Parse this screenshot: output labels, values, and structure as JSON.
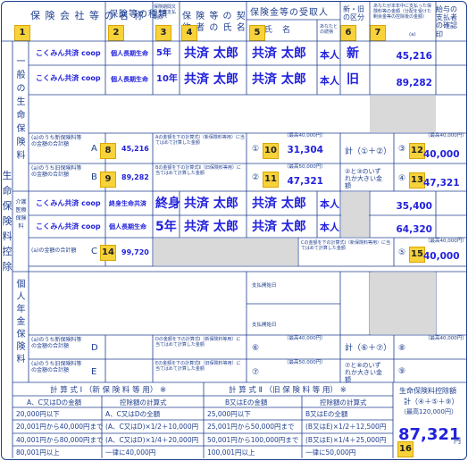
{
  "header": {
    "company": "保 険 会 社 等 の 名 称",
    "type": "保険等の種類",
    "period": "保険期間又は年金支払期間",
    "contractor": "保 険 等 の 契 約 者 の 氏 名",
    "recipient": "保険金等の受取人",
    "recipient_name": "氏　名",
    "relation": "あなたとの続柄",
    "newold": "新・旧の区分",
    "amount": "あなたが本年中に支払った保険料等の金額（分配を受けた剰余金等の控除後の金額）",
    "confirm": "給与の支払者の確認印",
    "col_a": "(a)"
  },
  "badges": [
    "1",
    "2",
    "3",
    "4",
    "5",
    "6",
    "7",
    "8",
    "9",
    "10",
    "11",
    "12",
    "13",
    "14",
    "15",
    "16"
  ],
  "section": {
    "main": "生命保険料控除",
    "general": "一般の生命保険料",
    "care": "介護医療保険料",
    "pension": "個人年金保険料"
  },
  "general_rows": [
    {
      "company": "こくみん共済 coop",
      "type": "個人長期生命",
      "period": "5年",
      "contractor": "共済 太郎",
      "recipient": "共済 太郎",
      "relation": "本人",
      "newold": "新",
      "amount": "45,216"
    },
    {
      "company": "こくみん共済 coop",
      "type": "個人長期生命",
      "period": "10年",
      "contractor": "共済 太郎",
      "recipient": "共済 太郎",
      "relation": "本人",
      "newold": "旧",
      "amount": "89,282"
    }
  ],
  "general_totals": {
    "a_label": "(a)のうち新保険料等の金額の合計額",
    "a_letter": "A",
    "a_value": "45,216",
    "a_text": "Aの金額を下の計算式Ⅰ（新保険料等用）に当てはめて計算した金額",
    "a_circ": "①",
    "a_result": "31,304",
    "a_max": "（最高40,000円）",
    "b_label": "(a)のうち旧保険料等の金額の合計額",
    "b_letter": "B",
    "b_value": "89,282",
    "b_text": "Bの金額を下の計算式Ⅱ（旧保険料等用）に当てはめて計算した金額",
    "b_circ": "②",
    "b_result": "47,321",
    "b_max": "（最高50,000円）",
    "calc": "計（①＋②）",
    "calc_circ": "③",
    "calc_value": "40,000",
    "calc_max": "（最高40,000円）",
    "compare": "②と③のいずれか大きい金額",
    "compare_circ": "④",
    "compare_value": "47,321",
    "yen": "円"
  },
  "care_rows": [
    {
      "company": "こくみん共済 coop",
      "type": "終身生命共済",
      "period": "終身",
      "contractor": "共済 太郎",
      "recipient": "共済 太郎",
      "relation": "本人",
      "amount": "35,400"
    },
    {
      "company": "こくみん共済 coop",
      "type": "個人長期生命",
      "period": "5年",
      "contractor": "共済 太郎",
      "recipient": "共済 太郎",
      "relation": "本人",
      "amount": "64,320"
    }
  ],
  "care_totals": {
    "label": "(a)の金額の合計額",
    "letter": "C",
    "value": "99,720",
    "text": "Cの金額を下の計算式Ⅰ（新保険料等用）に当てはめて計算した金額",
    "circ": "⑤",
    "result": "40,000",
    "max": "（最高40,000円）"
  },
  "pension": {
    "start_label": "支払開始日",
    "d_label": "(a)のうち新保険料等の金額の合計額",
    "d_letter": "D",
    "d_text": "Dの金額を下の計算式Ⅰ（新保険料等用）に当てはめて計算した金額",
    "d_circ": "⑥",
    "d_max": "（最高40,000円）",
    "e_label": "(a)のうち旧保険料等の金額の合計額",
    "e_letter": "E",
    "e_text": "Eの金額を下の計算式Ⅱ（旧保険料等用）に当てはめて計算した金額",
    "e_circ": "⑦",
    "e_max": "（最高50,000円）",
    "calc": "計（⑥＋⑦）",
    "calc_circ": "⑧",
    "calc_max": "（最高40,000円）",
    "compare": "⑦と⑧のいずれか大きい金額",
    "compare_circ": "⑨"
  },
  "formula1": {
    "title": "計 算 式 Ⅰ （新 保 険 料 等 用） ※",
    "h1": "A、C又はDの金額",
    "h2": "控除額の計算式",
    "rows": [
      [
        "20,000円以下",
        "A、C又はDの全額"
      ],
      [
        "20,001円から40,000円まで",
        "(A、C又はD)×1/2＋10,000円"
      ],
      [
        "40,001円から80,000円まで",
        "(A、C又はD)×1/4＋20,000円"
      ],
      [
        "80,001円以上",
        "一律に40,000円"
      ]
    ]
  },
  "formula2": {
    "title": "計 算 式 Ⅱ （旧 保 険 料 等 用） ※",
    "h1": "B又はEの金額",
    "h2": "控除額の計算式",
    "rows": [
      [
        "25,000円以下",
        "B又はEの全額"
      ],
      [
        "25,001円から50,000円まで",
        "(B又はE)×1/2＋12,500円"
      ],
      [
        "50,001円から100,000円まで",
        "(B又はE)×1/4＋25,000円"
      ],
      [
        "100,001円以上",
        "一律に50,000円"
      ]
    ]
  },
  "total": {
    "title": "生命保険料控除額",
    "formula": "計（④＋⑤＋⑨）",
    "max": "（最高120,000円）",
    "value": "87,321",
    "yen": "円"
  }
}
